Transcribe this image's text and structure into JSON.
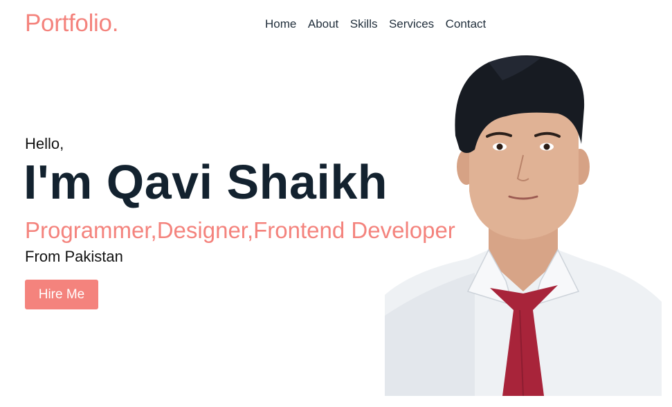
{
  "header": {
    "logo": "Portfolio.",
    "nav": [
      "Home",
      "About",
      "Skills",
      "Services",
      "Contact"
    ]
  },
  "hero": {
    "greeting": "Hello,",
    "name": "I'm Qavi Shaikh",
    "roles": "Programmer,Designer,Frontend Developer",
    "origin": "From Pakistan",
    "cta_label": "Hire Me"
  },
  "colors": {
    "accent": "#f4837d",
    "heading": "#13222f",
    "tie": "#a8243a",
    "shirt": "#eef1f4"
  }
}
